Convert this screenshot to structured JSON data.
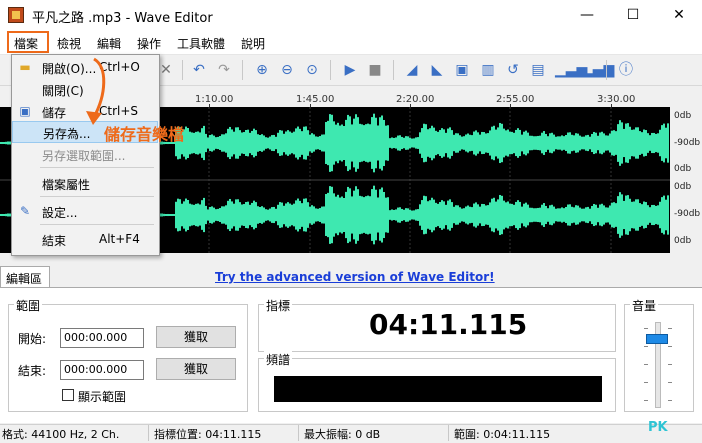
{
  "window": {
    "title": "平凡之路 .mp3 - Wave Editor",
    "minimize": "—",
    "maximize": "☐",
    "close": "✕"
  },
  "menubar": {
    "items": [
      "檔案",
      "檢視",
      "編輯",
      "操作",
      "工具軟體",
      "說明"
    ]
  },
  "timeline": {
    "ticks": [
      "1:10.00",
      "1:45.00",
      "2:20.00",
      "2:55.00",
      "3:30.00"
    ]
  },
  "db_scale": {
    "labels": [
      "0db",
      "-90db",
      "0db",
      "0db",
      "-90db",
      "0db"
    ]
  },
  "file_menu": {
    "items": [
      {
        "label": "開啟(O)...",
        "shortcut": "Ctrl+O",
        "icon": "folder-icon"
      },
      {
        "label": "關閉(C)",
        "shortcut": ""
      },
      {
        "label": "儲存",
        "shortcut": "Ctrl+S",
        "icon": "save-icon"
      },
      {
        "label": "另存為...",
        "shortcut": ""
      },
      {
        "label": "另存選取範圍...",
        "shortcut": "",
        "disabled": true
      },
      {
        "label": "檔案屬性",
        "shortcut": ""
      },
      {
        "label": "設定...",
        "shortcut": "",
        "icon": "settings-icon"
      },
      {
        "label": "結束",
        "shortcut": "Alt+F4"
      }
    ]
  },
  "callout": {
    "text": "儲存音樂檔",
    "color": "#ee6a1a"
  },
  "tabs": {
    "edit": "編輯區"
  },
  "promo": {
    "link": "Try the advanced version of Wave Editor!"
  },
  "range": {
    "group": "範圍",
    "start_label": "開始:",
    "start_value": "000:00.000",
    "end_label": "結束:",
    "end_value": "000:00.000",
    "pick": "獲取",
    "show_range": "顯示範圍"
  },
  "cursor": {
    "group": "指標",
    "time": "04:11.115"
  },
  "spectrum": {
    "group": "頻譜"
  },
  "volume": {
    "group": "音量"
  },
  "status": {
    "format": "格式: 44100 Hz, 2 Ch.",
    "cursor_pos": "指標位置: 04:11.115",
    "max_amp": "最大振幅: 0 dB",
    "range": "範圍: 0:04:11.115"
  },
  "watermark": "PK",
  "colors": {
    "waveform": "#3ee8b0",
    "accent": "#ee6a1a",
    "link": "#1a3ed8",
    "volume_thumb": "#1e8ae6"
  }
}
